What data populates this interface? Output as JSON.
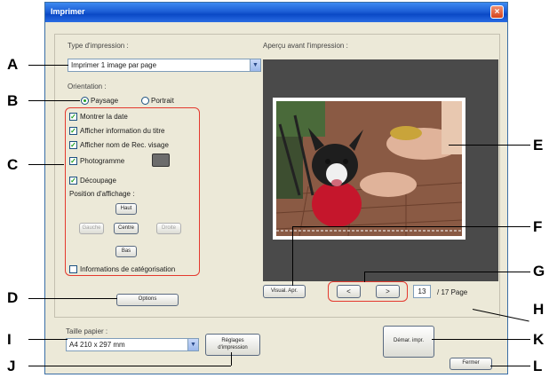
{
  "window": {
    "title": "Imprimer"
  },
  "print_type": {
    "label": "Type d'impression :",
    "value": "Imprimer 1 image par page"
  },
  "orientation": {
    "label": "Orientation :",
    "landscape": "Paysage",
    "portrait": "Portrait",
    "selected": "Paysage"
  },
  "options": {
    "show_date": "Montrer la date",
    "show_title": "Afficher information du titre",
    "show_face_name": "Afficher nom de Rec. visage",
    "frame": "Photogramme",
    "crop": "Découpage",
    "position_label": "Position d'affichage :",
    "pos_top": "Haut",
    "pos_left": "Gauche",
    "pos_center": "Centre",
    "pos_right": "Droite",
    "pos_bottom": "Bas",
    "categorization": "Informations de catégorisation"
  },
  "options_button": "Options",
  "preview": {
    "label": "Aperçu avant l'impression :",
    "print_preview_button": "Visual. Apr.",
    "prev": "<",
    "next": ">",
    "page": "13",
    "page_total": "/ 17 Page"
  },
  "paper": {
    "label": "Taille papier :",
    "value": "A4 210 x 297 mm",
    "settings_button": "Réglages d'impression"
  },
  "start_print_button": "Démar. impr.",
  "close_button": "Fermer",
  "callouts": [
    "A",
    "B",
    "C",
    "D",
    "E",
    "F",
    "G",
    "H",
    "I",
    "J",
    "K",
    "L"
  ],
  "colors": {
    "titlebar": "#0a49c6",
    "callout_box": "#e4392e",
    "check": "#21a121"
  }
}
